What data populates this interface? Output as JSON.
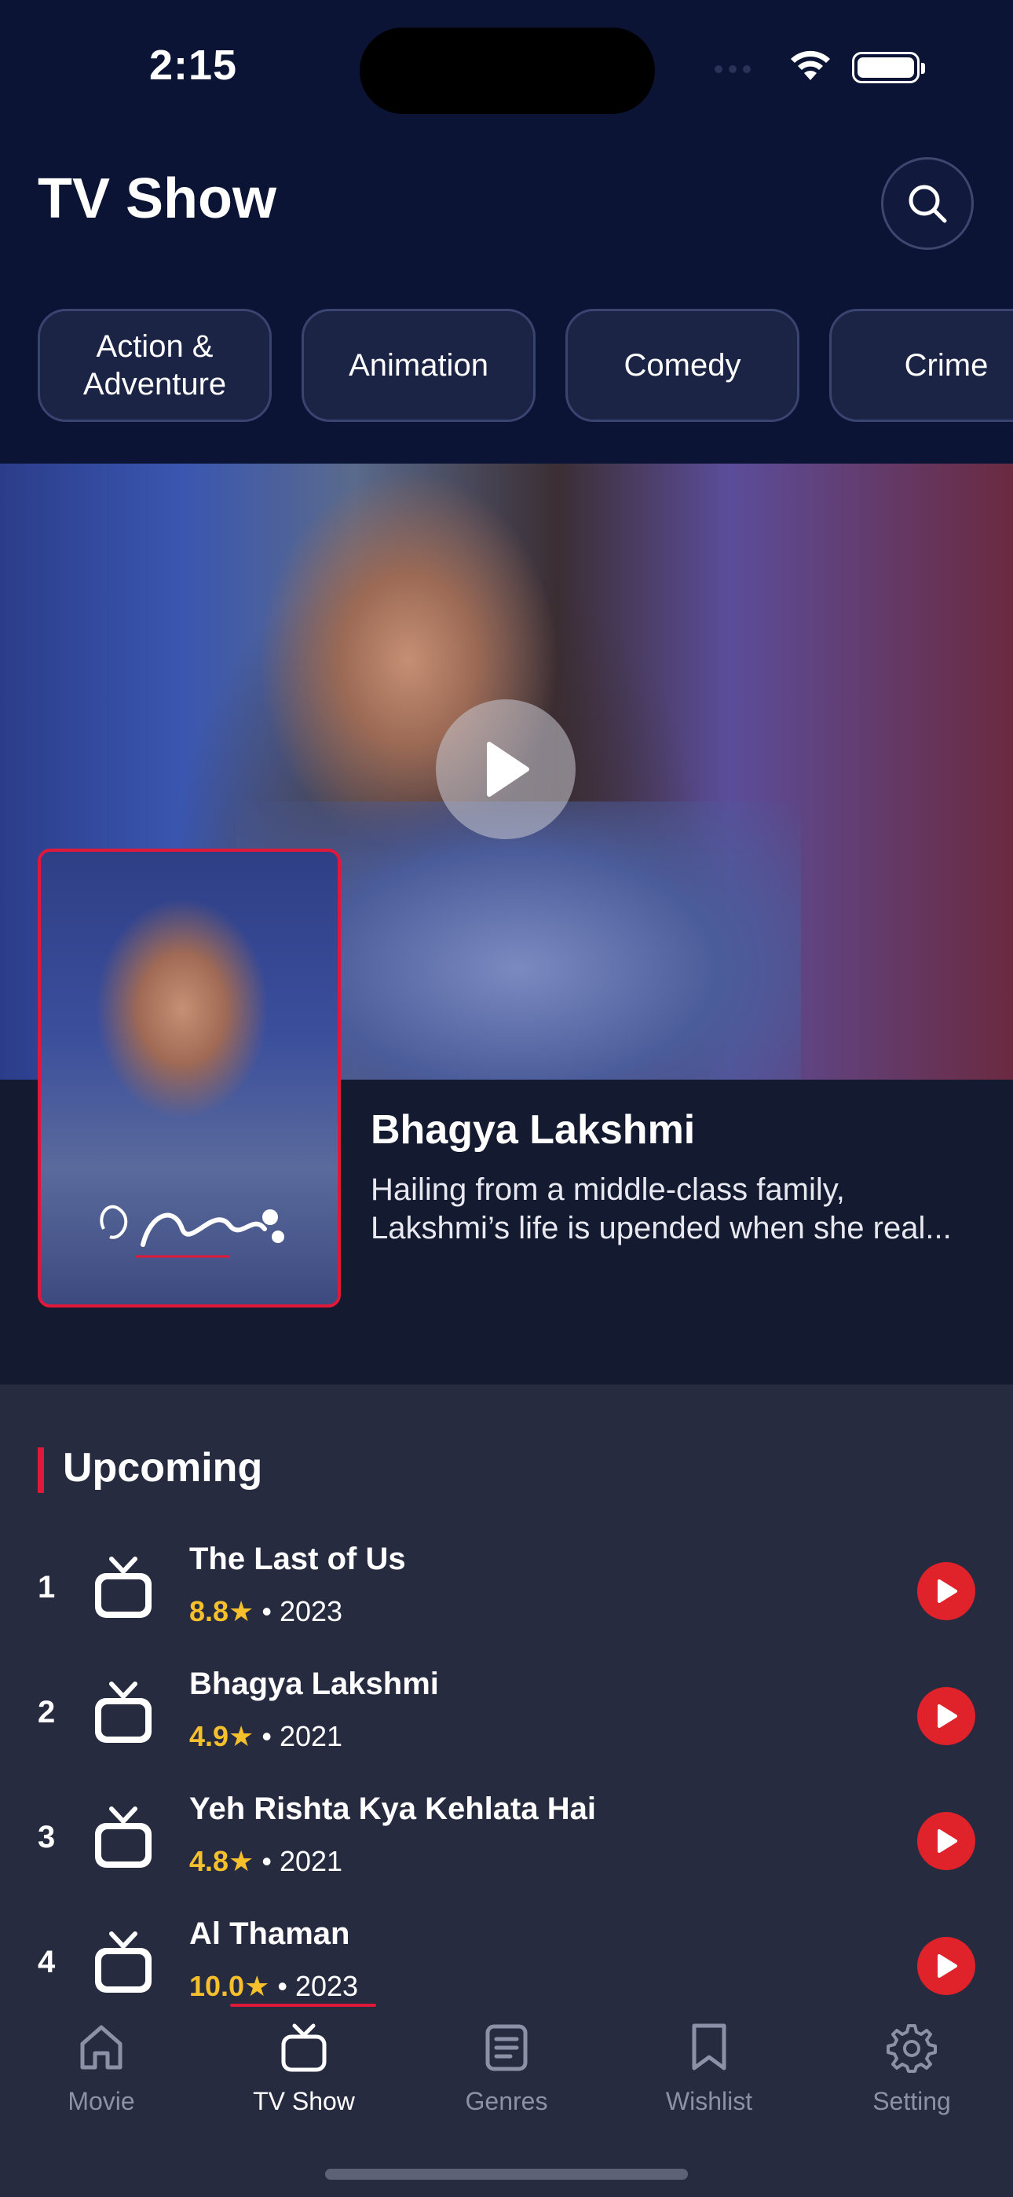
{
  "status_bar": {
    "time": "2:15"
  },
  "header": {
    "title": "TV Show"
  },
  "genres": [
    "Action & Adventure",
    "Animation",
    "Comedy",
    "Crime"
  ],
  "featured": {
    "title": "Bhagya Lakshmi",
    "description": "Hailing from a middle-class family, Lakshmi’s life is upended when she real..."
  },
  "upcoming": {
    "title": "Upcoming",
    "items": [
      {
        "rank": "1",
        "title": "The Last of Us",
        "rating": "8.8",
        "year": "2023"
      },
      {
        "rank": "2",
        "title": "Bhagya Lakshmi",
        "rating": "4.9",
        "year": "2021"
      },
      {
        "rank": "3",
        "title": "Yeh Rishta Kya Kehlata Hai",
        "rating": "4.8",
        "year": "2021"
      },
      {
        "rank": "4",
        "title": "Al Thaman",
        "rating": "10.0",
        "year": "2023"
      }
    ]
  },
  "tabbar": {
    "tabs": [
      {
        "label": "Movie",
        "icon": "home-icon"
      },
      {
        "label": "TV Show",
        "icon": "tv-icon"
      },
      {
        "label": "Genres",
        "icon": "list-icon"
      },
      {
        "label": "Wishlist",
        "icon": "bookmark-icon"
      },
      {
        "label": "Setting",
        "icon": "gear-icon"
      }
    ],
    "active": "TV Show"
  },
  "colors": {
    "accent": "#e0183a",
    "rating": "#f5c02c",
    "background": "#0b1434",
    "list_bg": "#272b40"
  }
}
